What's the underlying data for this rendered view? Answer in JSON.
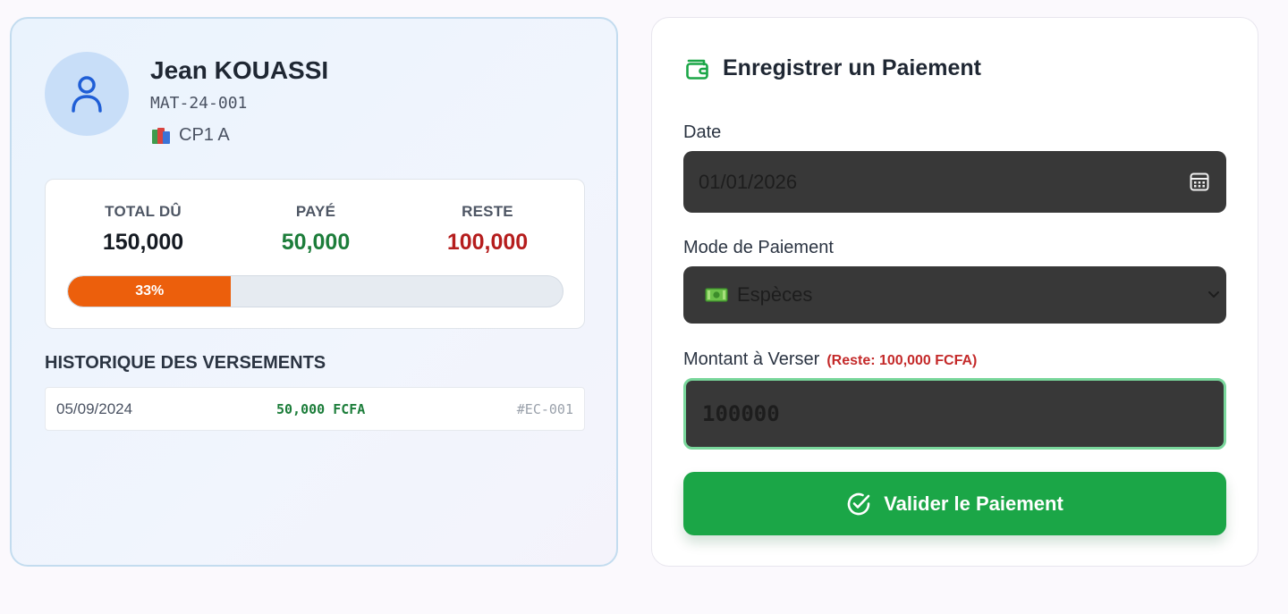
{
  "student": {
    "name": "Jean KOUASSI",
    "matricule": "MAT-24-001",
    "class_name": "CP1 A"
  },
  "summary": {
    "total_label": "TOTAL DÛ",
    "total_value": "150,000",
    "paid_label": "PAYÉ",
    "paid_value": "50,000",
    "rest_label": "RESTE",
    "rest_value": "100,000",
    "progress_percent": 33,
    "progress_text": "33%"
  },
  "history": {
    "title": "HISTORIQUE DES VERSEMENTS",
    "rows": [
      {
        "date": "05/09/2024",
        "amount": "50,000 FCFA",
        "ref": "#EC-001"
      }
    ]
  },
  "payment_form": {
    "title": "Enregistrer un Paiement",
    "date_label": "Date",
    "date_value": "01/01/2026",
    "mode_label": "Mode de Paiement",
    "mode_value": "Espèces",
    "amount_label": "Montant à Verser",
    "amount_hint": "(Reste: 100,000 FCFA)",
    "amount_value": "100000",
    "submit_label": "Valider le Paiement"
  },
  "colors": {
    "accent_green": "#1ba647",
    "paid_green": "#1c7d3a",
    "rest_red": "#b51d1d",
    "progress_orange": "#ec5f0c"
  },
  "icons": [
    "user-icon",
    "books-icon",
    "wallet-icon",
    "calendar-icon",
    "banknote-icon",
    "chevron-down-icon",
    "check-circle-icon"
  ]
}
